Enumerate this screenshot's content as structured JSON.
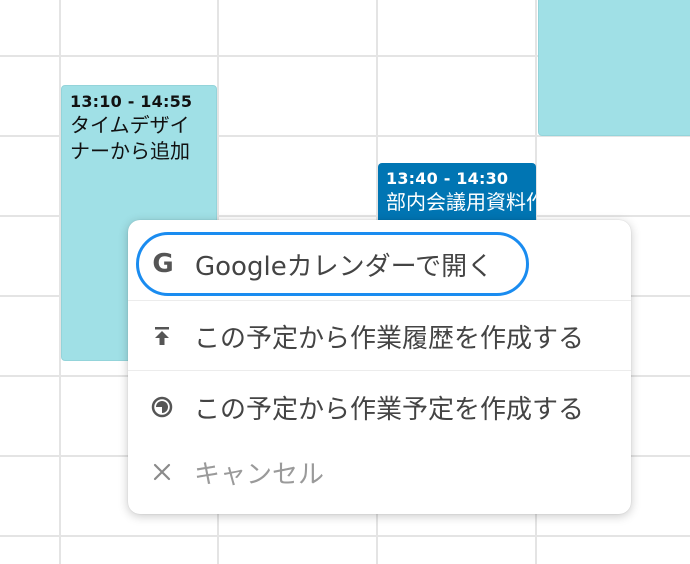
{
  "calendar": {
    "events": [
      {
        "time": "13:10 - 14:55",
        "title": "タイムデザイナーから追加",
        "color": "#a0e0e6"
      },
      {
        "time": "13:40 - 14:30",
        "title": "部内会議用資料作成",
        "color": "#0075b3"
      },
      {
        "time": "",
        "title": "",
        "color": "#a0e0e6"
      }
    ]
  },
  "context_menu": {
    "items": [
      {
        "label": "Googleカレンダーで開く",
        "icon": "google-g-icon"
      },
      {
        "label": "この予定から作業履歴を作成する",
        "icon": "upload-arrow-icon"
      },
      {
        "label": "この予定から作業予定を作成する",
        "icon": "half-circle-clock-icon"
      },
      {
        "label": "キャンセル",
        "icon": "close-icon"
      }
    ],
    "highlight_color": "#1a8cf0"
  }
}
